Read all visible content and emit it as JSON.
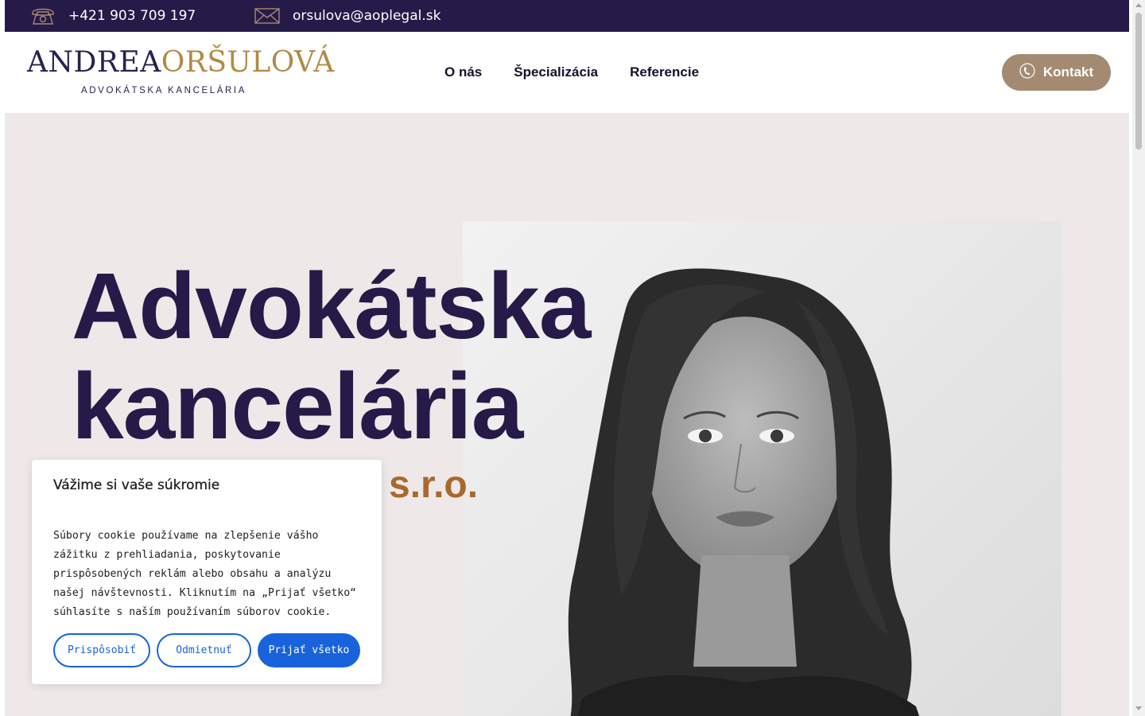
{
  "topbar": {
    "phone": "+421 903 709 197",
    "email": "orsulova@aoplegal.sk",
    "phone_icon": "telephone-icon",
    "email_icon": "envelope-icon"
  },
  "logo": {
    "name_part1": "ANDREA",
    "name_part2": "ORŠULOVÁ",
    "subtitle": "ADVOKÁTSKA KANCELÁRIA"
  },
  "nav": {
    "items": [
      "O nás",
      "Špecializácia",
      "Referencie"
    ]
  },
  "contact_button": {
    "label": "Kontakt",
    "icon": "phone-icon"
  },
  "hero": {
    "title_line1": "Advokátska",
    "title_line2": "kancelária",
    "subtitle": "s.r.o."
  },
  "cookie": {
    "title": "Vážime si vaše súkromie",
    "text": "Súbory cookie používame na zlepšenie vášho zážitku z prehliadania, poskytovanie prispôsobených reklám alebo obsahu a analýzu našej návštevnosti. Kliknutím na „Prijať všetko“ súhlasíte s naším používaním súborov cookie.",
    "customize": "Prispôsobiť",
    "reject": "Odmietnuť",
    "accept": "Prijať všetko"
  },
  "colors": {
    "topbar_bg": "#261a48",
    "brand_navy": "#261a48",
    "brand_gold": "#b08a45",
    "accent_bronze": "#a8692d",
    "contact_button_bg": "#a48a72",
    "hero_bg": "#efe8e8",
    "cookie_blue": "#1863dc"
  }
}
